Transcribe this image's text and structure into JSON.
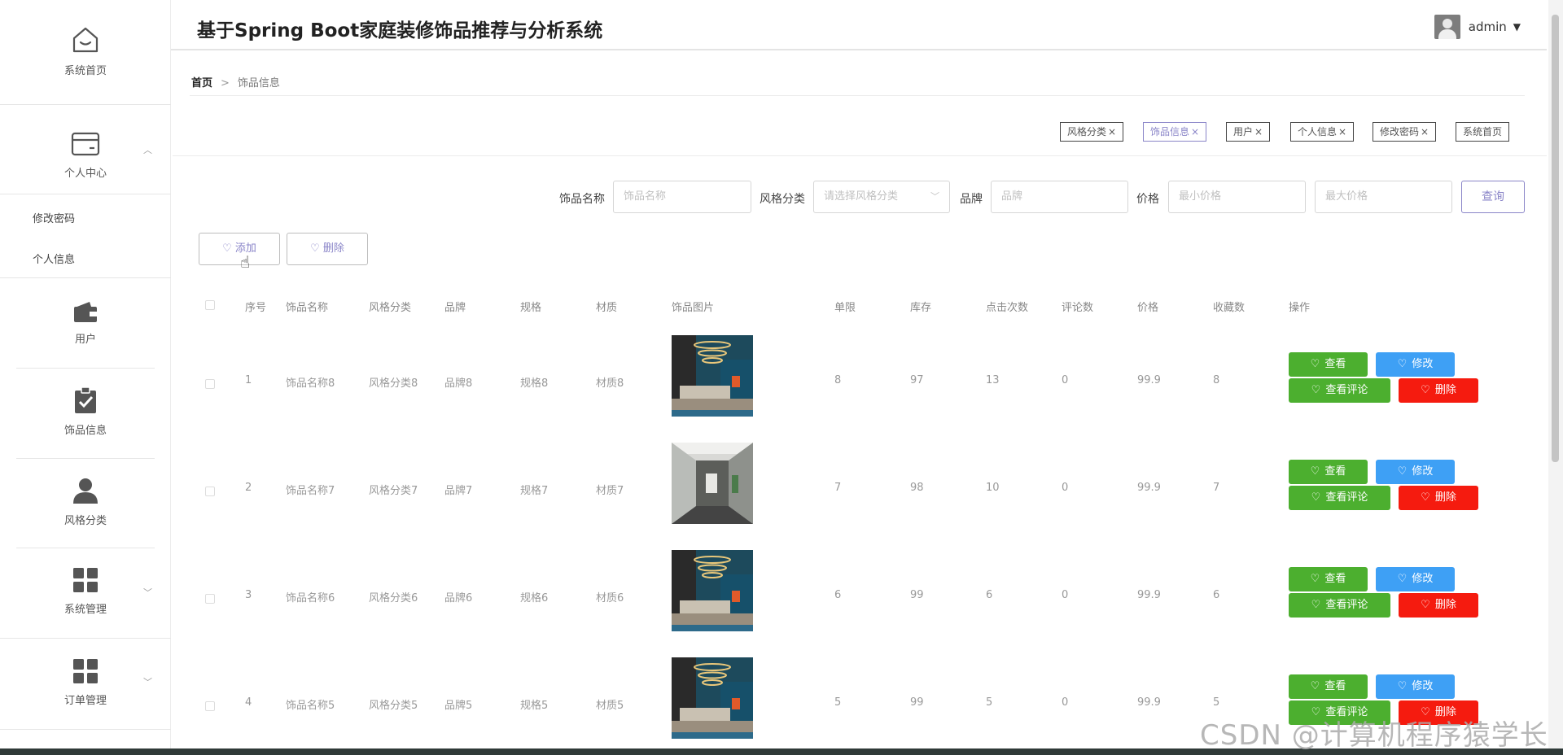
{
  "header": {
    "title": "基于Spring Boot家庭装修饰品推荐与分析系统",
    "user": "admin"
  },
  "sidebar": {
    "home": "系统首页",
    "personal_center": "个人中心",
    "sub_items": [
      "修改密码",
      "个人信息"
    ],
    "users": "用户",
    "decor_info": "饰品信息",
    "style_category": "风格分类",
    "system_mgmt": "系统管理",
    "order_mgmt": "订单管理"
  },
  "breadcrumb": {
    "home": "首页",
    "separator": ">",
    "current": "饰品信息"
  },
  "tags": [
    {
      "label": "风格分类",
      "close": "×",
      "active": false
    },
    {
      "label": "饰品信息",
      "close": "×",
      "active": true
    },
    {
      "label": "用户",
      "close": "×",
      "active": false
    },
    {
      "label": "个人信息",
      "close": "×",
      "active": false
    },
    {
      "label": "修改密码",
      "close": "×",
      "active": false
    },
    {
      "label": "系统首页",
      "close": "",
      "active": false
    }
  ],
  "search": {
    "name_label": "饰品名称",
    "name_placeholder": "饰品名称",
    "style_label": "风格分类",
    "style_placeholder": "请选择风格分类",
    "brand_label": "品牌",
    "brand_placeholder": "品牌",
    "price_label": "价格",
    "min_price_placeholder": "最小价格",
    "max_price_placeholder": "最大价格",
    "query_button": "查询"
  },
  "actions": {
    "add": "添加",
    "delete": "删除"
  },
  "table": {
    "columns": [
      "序号",
      "饰品名称",
      "风格分类",
      "品牌",
      "规格",
      "材质",
      "饰品图片",
      "单限",
      "库存",
      "点击次数",
      "评论数",
      "价格",
      "收藏数",
      "操作"
    ],
    "rows": [
      {
        "index": "1",
        "name": "饰品名称8",
        "style": "风格分类8",
        "brand": "品牌8",
        "spec": "规格8",
        "material": "材质8",
        "image": "chandelier",
        "limit": "8",
        "stock": "97",
        "clicks": "13",
        "comments": "0",
        "price": "99.9",
        "favorites": "8"
      },
      {
        "index": "2",
        "name": "饰品名称7",
        "style": "风格分类7",
        "brand": "品牌7",
        "spec": "规格7",
        "material": "材质7",
        "image": "corridor",
        "limit": "7",
        "stock": "98",
        "clicks": "10",
        "comments": "0",
        "price": "99.9",
        "favorites": "7"
      },
      {
        "index": "3",
        "name": "饰品名称6",
        "style": "风格分类6",
        "brand": "品牌6",
        "spec": "规格6",
        "material": "材质6",
        "image": "chandelier",
        "limit": "6",
        "stock": "99",
        "clicks": "6",
        "comments": "0",
        "price": "99.9",
        "favorites": "6"
      },
      {
        "index": "4",
        "name": "饰品名称5",
        "style": "风格分类5",
        "brand": "品牌5",
        "spec": "规格5",
        "material": "材质5",
        "image": "chandelier",
        "limit": "5",
        "stock": "99",
        "clicks": "5",
        "comments": "0",
        "price": "99.9",
        "favorites": "5"
      }
    ],
    "row_buttons": {
      "view": "查看",
      "edit": "修改",
      "view_comments": "查看评论",
      "delete": "删除"
    }
  },
  "watermark": "CSDN @计算机程序猿学长",
  "colors": {
    "accent": "#8a85c8",
    "view_button": "#4caf2f",
    "edit_button": "#3ea0f5",
    "delete_button": "#f51b0f"
  }
}
